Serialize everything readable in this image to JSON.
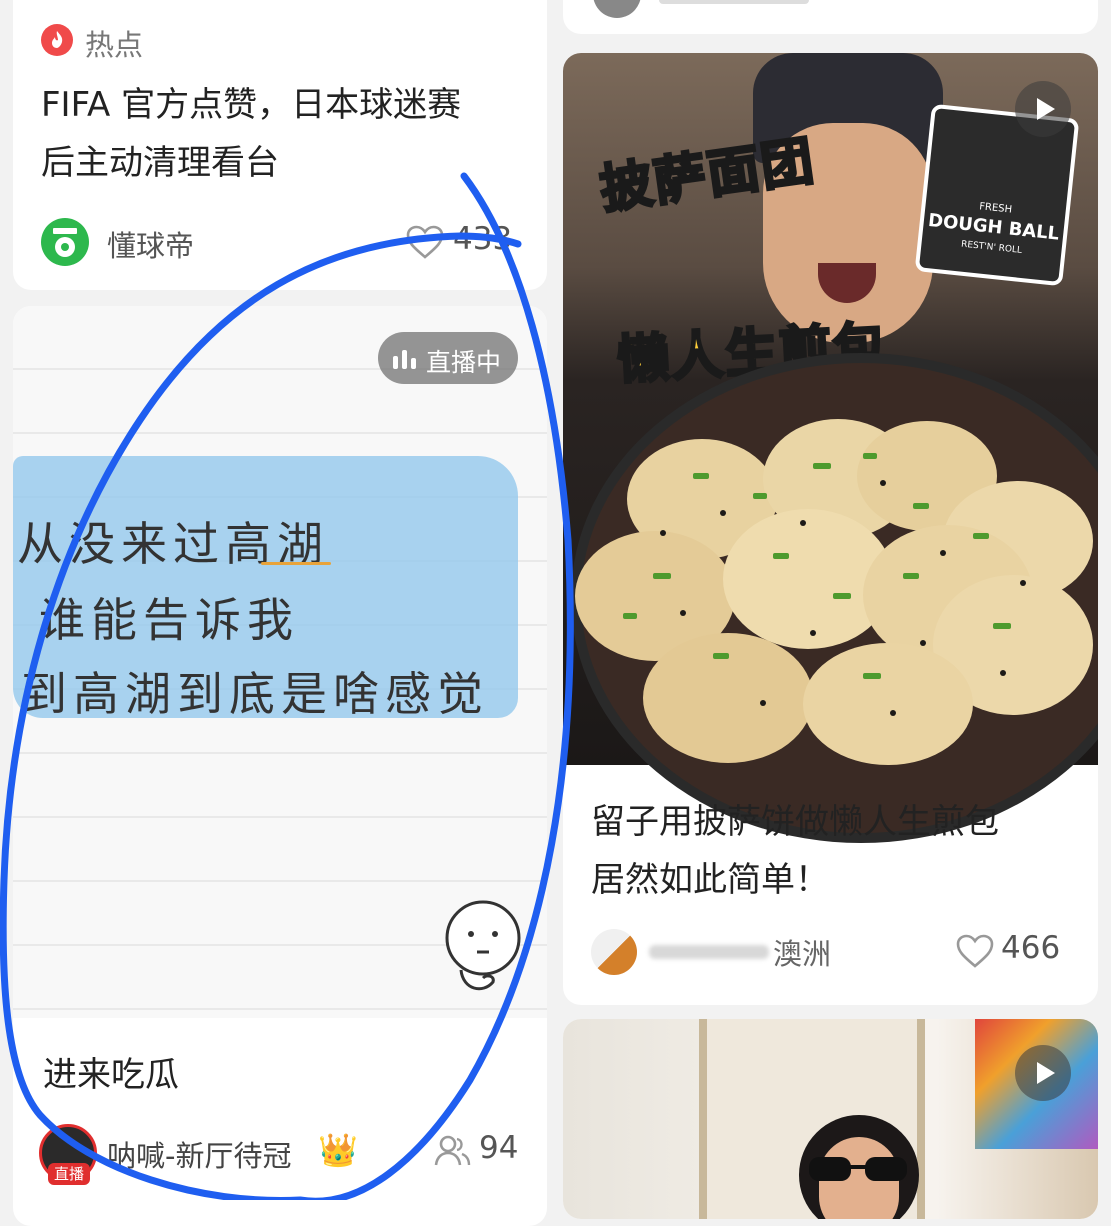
{
  "left_column": {
    "card_hot": {
      "badge": "热点",
      "title_line1": "FIFA 官方点赞，日本球迷赛",
      "title_line2": "后主动清理看台",
      "author": "懂球帝",
      "likes": "433"
    },
    "card_live": {
      "live_badge": "直播中",
      "note_line1": "从没来过高湖",
      "note_line2": "谁能告诉我",
      "note_line3": "到高湖到底是啥感觉",
      "title": "进来吃瓜",
      "author": "呐喊-新厅待冠",
      "crown": "👑",
      "avatar_badge": "直播",
      "viewers": "94"
    }
  },
  "right_column": {
    "card_food": {
      "overlay_top": "披萨面团",
      "overlay_middle": "懒人生煎包",
      "package_small": "FRESH",
      "package_label": "DOUGH BALL",
      "package_sub": "REST'N' ROLL",
      "title_line1": "留子用披萨饼做懒人生煎包",
      "title_line2": "居然如此简单！",
      "author": "澳洲",
      "likes": "466"
    },
    "card_bottom": {}
  },
  "colors": {
    "hot_badge": "#f04a4a",
    "annotation_stroke": "#1f5ef0",
    "brand_green": "#2db84d",
    "live_red": "#e02e2e"
  }
}
